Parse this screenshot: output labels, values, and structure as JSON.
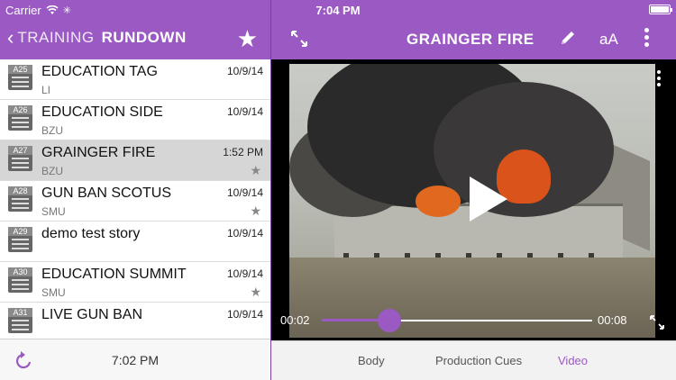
{
  "status": {
    "carrier": "Carrier",
    "time": "7:04 PM"
  },
  "nav": {
    "back_label": "TRAINING",
    "section_label": "RUNDOWN",
    "story_title": "GRAINGER FIRE",
    "text_size_label": "aA"
  },
  "stories": [
    {
      "num": "A25",
      "slug": "EDUCATION TAG",
      "sub": "LI",
      "date": "10/9/14",
      "starred": false,
      "selected": false
    },
    {
      "num": "A26",
      "slug": "EDUCATION SIDE",
      "sub": "BZU",
      "date": "10/9/14",
      "starred": false,
      "selected": false
    },
    {
      "num": "A27",
      "slug": "GRAINGER FIRE",
      "sub": "BZU",
      "date": "1:52 PM",
      "starred": true,
      "selected": true
    },
    {
      "num": "A28",
      "slug": "GUN BAN SCOTUS",
      "sub": "SMU",
      "date": "10/9/14",
      "starred": true,
      "selected": false
    },
    {
      "num": "A29",
      "slug": "demo test story",
      "sub": "",
      "date": "10/9/14",
      "starred": false,
      "selected": false
    },
    {
      "num": "A30",
      "slug": "EDUCATION SUMMIT",
      "sub": "SMU",
      "date": "10/9/14",
      "starred": true,
      "selected": false
    },
    {
      "num": "A31",
      "slug": "LIVE GUN BAN",
      "sub": "",
      "date": "10/9/14",
      "starred": false,
      "selected": false
    }
  ],
  "left_footer": {
    "time": "7:02 PM"
  },
  "video": {
    "elapsed": "00:02",
    "duration": "00:08",
    "progress": 0.25
  },
  "tabs": [
    {
      "label": "Body",
      "active": false
    },
    {
      "label": "Production Cues",
      "active": false
    },
    {
      "label": "Video",
      "active": true
    }
  ],
  "colors": {
    "accent": "#9b59c4"
  }
}
